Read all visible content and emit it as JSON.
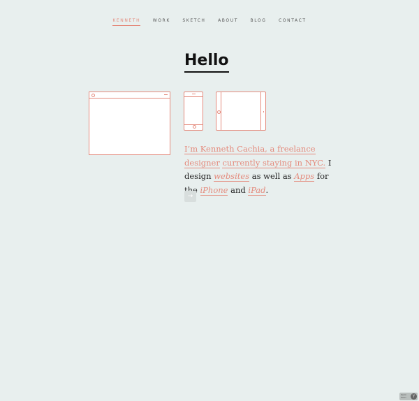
{
  "nav": {
    "items": [
      {
        "label": "KENNETH",
        "active": true
      },
      {
        "label": "WORK",
        "active": false
      },
      {
        "label": "SKETCH",
        "active": false
      },
      {
        "label": "ABOUT",
        "active": false
      },
      {
        "label": "BLOG",
        "active": false
      },
      {
        "label": "CONTACT",
        "active": false
      }
    ]
  },
  "main": {
    "heading": "Hello",
    "intro": {
      "part1": "I’m Kenneth Cachia, a freelance designer",
      "part2": "currently staying in NYC.",
      "part3": " I design ",
      "websites": "websites",
      "part4": " as well as ",
      "apps": "Apps",
      "part5": " for the ",
      "iphone": "iPhone",
      "part6": " and ",
      "ipad": "iPad",
      "part7": "."
    },
    "arrow": "→"
  },
  "badge": {
    "text": "Kevin Tsian",
    "logo": "Y"
  },
  "colors": {
    "background": "#e8efee",
    "accent": "#e48a7c",
    "text": "#222222"
  },
  "icons": [
    "browser-sketch-icon",
    "phone-sketch-icon",
    "tablet-sketch-icon",
    "arrow-right-icon"
  ]
}
